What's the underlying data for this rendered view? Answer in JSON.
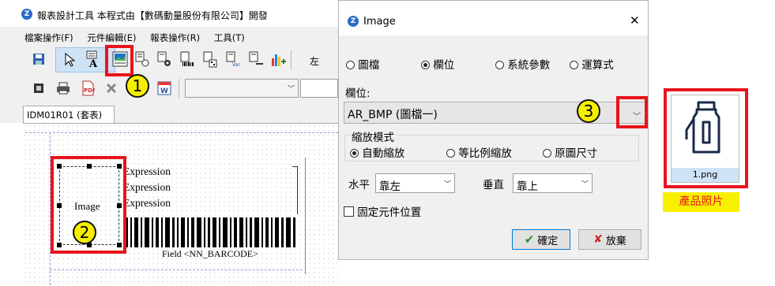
{
  "main_window": {
    "title": "報表設計工具   本程式由【數碼動量股份有限公司】開發",
    "menu": [
      "檔案操作(F)",
      "元件編輯(E)",
      "報表操作(R)",
      "工具(T)"
    ],
    "toolbar_partial_text": "左",
    "tab_label": "IDM01R01 (套表)"
  },
  "design_canvas": {
    "image_element_label": "Image",
    "expression_labels": [
      "Expression",
      "Expression",
      "Expression"
    ],
    "barcode_field_label": "Field <NN_BARCODE>"
  },
  "dialog": {
    "title": "Image",
    "close_symbol": "✕",
    "source_options": [
      {
        "label": "圖檔",
        "selected": false
      },
      {
        "label": "欄位",
        "selected": true
      },
      {
        "label": "系統參數",
        "selected": false
      },
      {
        "label": "運算式",
        "selected": false
      }
    ],
    "field_label": "欄位:",
    "field_value": "AR_BMP (圖檔一)",
    "scale_mode": {
      "legend": "縮放模式",
      "options": [
        {
          "label": "自動縮放",
          "selected": true
        },
        {
          "label": "等比例縮放",
          "selected": false
        },
        {
          "label": "原圖尺寸",
          "selected": false
        }
      ]
    },
    "horizontal": {
      "label": "水平",
      "value": "靠左"
    },
    "vertical": {
      "label": "垂直",
      "value": "靠上"
    },
    "fix_position_label": "固定元件位置",
    "fix_position_checked": false,
    "ok_label": "確定",
    "cancel_label": "放棄"
  },
  "callouts": [
    "1",
    "2",
    "3"
  ],
  "preview": {
    "filename": "1.png",
    "caption": "產品照片",
    "caption_bg": "#f7f000"
  },
  "colors": {
    "highlight": "#e8141b",
    "badge": "#f5f000",
    "dialog_bg": "#f0f0f0"
  }
}
